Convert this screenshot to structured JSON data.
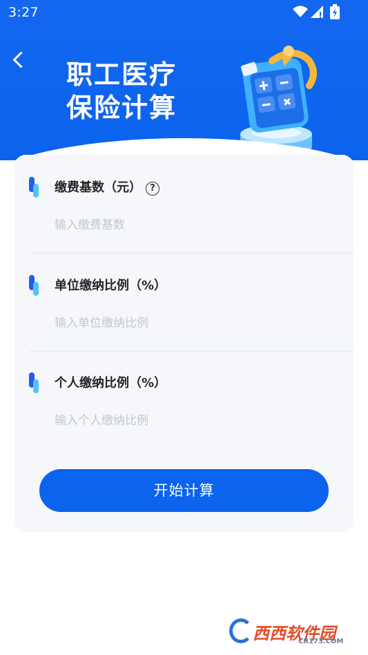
{
  "status_bar": {
    "time": "3:27"
  },
  "header": {
    "title_line1": "职工医疗",
    "title_line2": "保险计算"
  },
  "fields": [
    {
      "label": "缴费基数（元）",
      "placeholder": "输入缴费基数",
      "has_help": true
    },
    {
      "label": "单位缴纳比例（%）",
      "placeholder": "输入单位缴纳比例",
      "has_help": false
    },
    {
      "label": "个人缴纳比例（%）",
      "placeholder": "输入个人缴纳比例",
      "has_help": false
    }
  ],
  "help_glyph": "?",
  "button": {
    "label": "开始计算"
  },
  "watermark": {
    "name": "西西软件园",
    "sub": "CR173.COM"
  },
  "colors": {
    "primary": "#0b63ee",
    "card_bg": "#f5f7fa",
    "placeholder": "#c4c7cd"
  }
}
